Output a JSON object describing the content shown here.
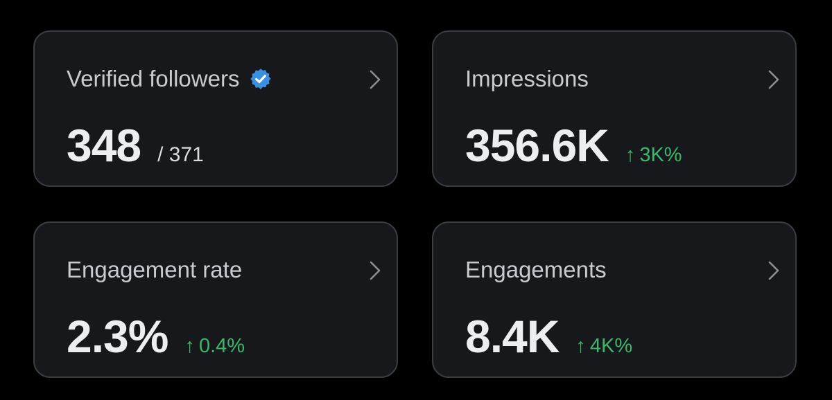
{
  "cards": [
    {
      "title": "Verified followers",
      "verified_icon": "verified-badge-icon",
      "value": "348",
      "sub": "/ 371"
    },
    {
      "title": "Impressions",
      "value": "356.6K",
      "change_arrow": "↑",
      "change": "3K%"
    },
    {
      "title": "Engagement rate",
      "value": "2.3%",
      "change_arrow": "↑",
      "change": "0.4%"
    },
    {
      "title": "Engagements",
      "value": "8.4K",
      "change_arrow": "↑",
      "change": "4K%"
    }
  ],
  "colors": {
    "background": "#000000",
    "card_bg": "#16181c",
    "card_border": "#3a3d42",
    "title": "#c8ccd0",
    "value": "#eceff2",
    "positive": "#3db76a",
    "verified": "#3b8fe0"
  }
}
